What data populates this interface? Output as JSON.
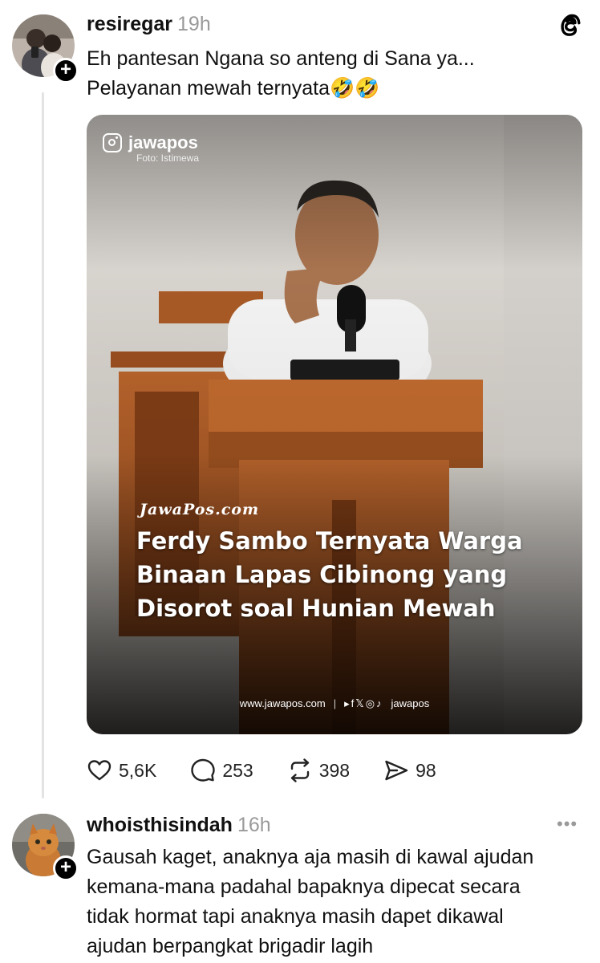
{
  "post1": {
    "username": "resiregar",
    "time": "19h",
    "text_line1": "Eh pantesan Ngana so anteng di Sana ya...",
    "text_line2": "Pelayanan mewah ternyata🤣🤣",
    "media": {
      "ig_handle": "jawapos",
      "photo_credit": "Foto: Istimewa",
      "brand": "JawaPos.com",
      "headline_line1": "Ferdy Sambo Ternyata Warga",
      "headline_line2": "Binaan Lapas Cibinong yang",
      "headline_line3": "Disorot soal Hunian Mewah",
      "footer_site": "www.jawapos.com",
      "footer_sep": "|",
      "footer_handle": "jawapos"
    },
    "actions": {
      "likes": "5,6K",
      "replies": "253",
      "reposts": "398",
      "shares": "98"
    }
  },
  "post2": {
    "username": "whoisthisindah",
    "time": "16h",
    "text_line1": "Gausah kaget, anaknya aja masih di kawal ajudan",
    "text_line2": "kemana-mana padahal bapaknya dipecat secara",
    "text_line3": "tidak hormat tapi anaknya masih dapet dikawal",
    "text_line4": "ajudan berpangkat brigadir lagih"
  },
  "icons": {
    "threads_logo": "threads-logo-icon",
    "heart": "heart-icon",
    "comment": "comment-icon",
    "repost": "repost-icon",
    "share": "share-icon",
    "more": "more-icon"
  }
}
